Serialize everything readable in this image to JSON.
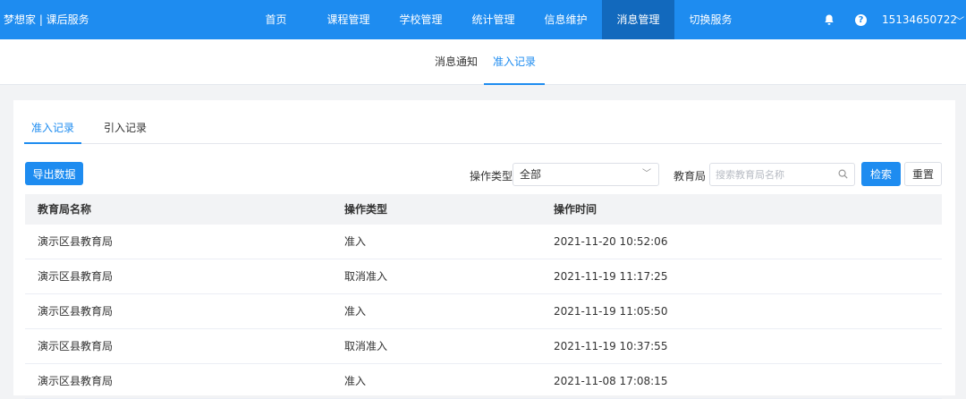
{
  "header": {
    "brand": "梦想家 | 课后服务",
    "nav": [
      "首页",
      "课程管理",
      "学校管理",
      "统计管理",
      "信息维护",
      "消息管理",
      "切换服务"
    ],
    "active_index": 5,
    "user": "15134650722",
    "chevron": "﹀"
  },
  "subnav": {
    "tabs": [
      "消息通知",
      "准入记录"
    ],
    "active_index": 1
  },
  "card": {
    "tabs": [
      "准入记录",
      "引入记录"
    ],
    "active_index": 0,
    "export_label": "导出数据",
    "filter": {
      "op_type_label": "操作类型",
      "op_type_value": "全部",
      "bureau_label": "教育局",
      "bureau_placeholder": "搜索教育局名称",
      "search_label": "检索",
      "reset_label": "重置"
    },
    "table": {
      "columns": [
        "教育局名称",
        "操作类型",
        "操作时间"
      ],
      "rows": [
        [
          "演示区县教育局",
          "准入",
          "2021-11-20 10:52:06"
        ],
        [
          "演示区县教育局",
          "取消准入",
          "2021-11-19 11:17:25"
        ],
        [
          "演示区县教育局",
          "准入",
          "2021-11-19 11:05:50"
        ],
        [
          "演示区县教育局",
          "取消准入",
          "2021-11-19 10:37:55"
        ],
        [
          "演示区县教育局",
          "准入",
          "2021-11-08 17:08:15"
        ]
      ]
    }
  },
  "icons": {
    "bell": "bell-icon",
    "help": "help-icon",
    "search": "search-icon",
    "select_arrow": "chevron-down-icon"
  },
  "colors": {
    "primary": "#1e8cf0",
    "nav_active": "#1269bd"
  }
}
